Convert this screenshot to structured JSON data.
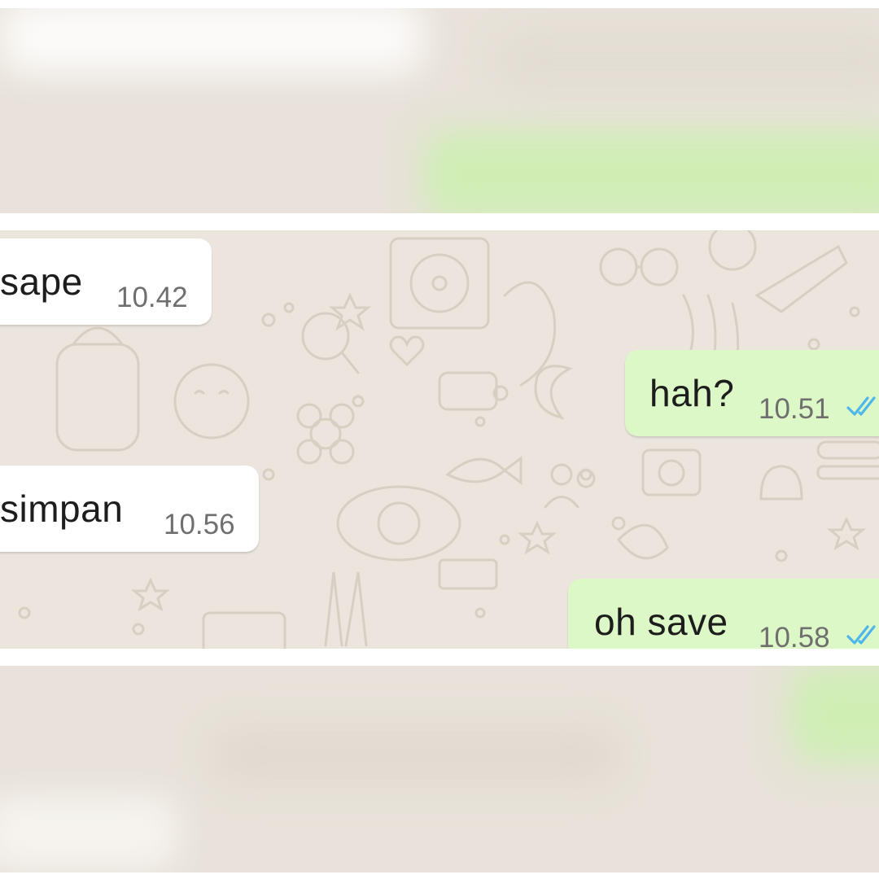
{
  "messages": [
    {
      "direction": "incoming",
      "text": "sape",
      "time": "10.42"
    },
    {
      "direction": "outgoing",
      "text": "hah?",
      "time": "10.51",
      "status_icon": "double-check-read-icon"
    },
    {
      "direction": "incoming",
      "text": "simpan",
      "time": "10.56"
    },
    {
      "direction": "outgoing",
      "text": "oh save",
      "time": "10.58",
      "status_icon": "double-check-read-icon"
    }
  ],
  "colors": {
    "chat_background": "#ebe5dd",
    "incoming_bubble": "#ffffff",
    "outgoing_bubble": "#dcf8c6",
    "read_receipt": "#4fb6ec"
  }
}
